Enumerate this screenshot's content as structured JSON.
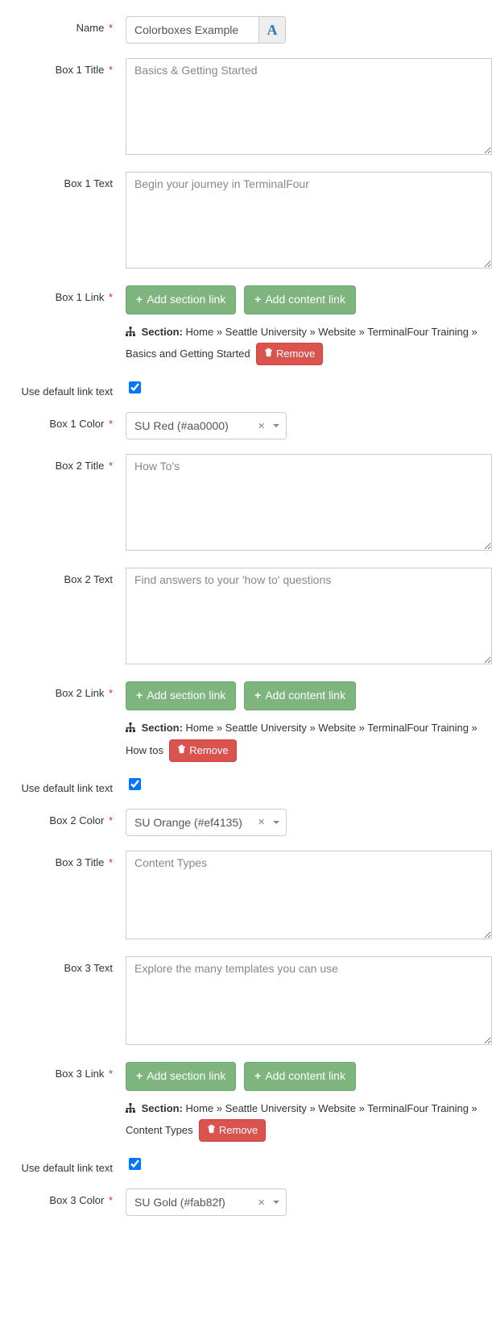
{
  "name": {
    "label": "Name",
    "value": "Colorboxes Example",
    "required": true
  },
  "box1": {
    "title_label": "Box 1 Title",
    "title_value": "Basics & Getting Started",
    "text_label": "Box 1 Text",
    "text_value": "Begin your journey in TerminalFour",
    "link_label": "Box 1 Link",
    "default_link_label": "Use default link text",
    "color_label": "Box 1 Color",
    "color_value": "SU Red (#aa0000)",
    "section_prefix": "Section:",
    "section_path": "Home » Seattle University » Website » TerminalFour Training » Basics and Getting Started"
  },
  "box2": {
    "title_label": "Box 2 Title",
    "title_value": "How To's",
    "text_label": "Box 2 Text",
    "text_value": "Find answers to your 'how to' questions",
    "link_label": "Box 2 Link",
    "default_link_label": "Use default link text",
    "color_label": "Box 2 Color",
    "color_value": "SU Orange (#ef4135)",
    "section_prefix": "Section:",
    "section_path": "Home » Seattle University » Website » TerminalFour Training » How tos"
  },
  "box3": {
    "title_label": "Box 3 Title",
    "title_value": "Content Types",
    "text_label": "Box 3 Text",
    "text_value": "Explore the many templates you can use",
    "link_label": "Box 3 Link",
    "default_link_label": "Use default link text",
    "color_label": "Box 3 Color",
    "color_value": "SU Gold (#fab82f)",
    "section_prefix": "Section:",
    "section_path": "Home » Seattle University » Website » TerminalFour Training » Content Types"
  },
  "buttons": {
    "add_section": "Add section link",
    "add_content": "Add content link",
    "remove": "Remove"
  }
}
